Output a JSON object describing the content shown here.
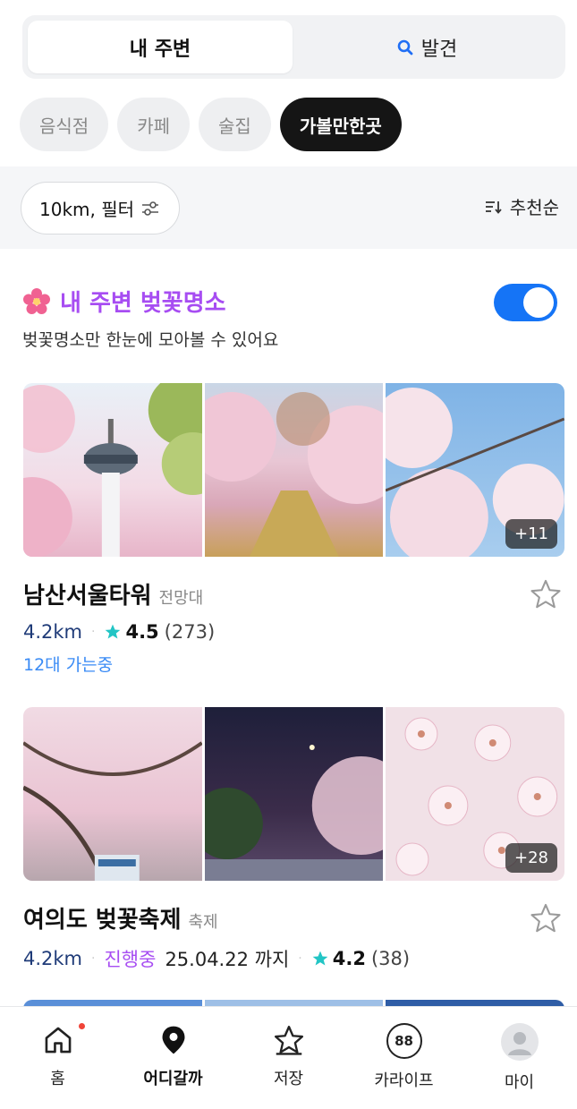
{
  "tabs": {
    "nearby": "내 주변",
    "discover": "발견"
  },
  "categories": [
    "음식점",
    "카페",
    "술집",
    "가볼만한곳"
  ],
  "filter": {
    "label": "10km, 필터",
    "sort": "추천순"
  },
  "section": {
    "title": "내 주변 벚꽃명소",
    "subtitle": "벚꽃명소만 한눈에 모아볼 수 있어요",
    "toggle_on": true
  },
  "places": [
    {
      "name": "남산서울타워",
      "category": "전망대",
      "distance": "4.2km",
      "rating": "4.5",
      "reviews": "(273)",
      "going": "12대 가는중",
      "more_photos": "+11"
    },
    {
      "name": "여의도 벚꽃축제",
      "category": "축제",
      "distance": "4.2km",
      "status": "진행중",
      "until": "25.04.22 까지",
      "rating": "4.2",
      "reviews": "(38)",
      "more_photos": "+28"
    }
  ],
  "nav": {
    "home": "홈",
    "where": "어디갈까",
    "saved": "저장",
    "kalife": "카라이프",
    "kalife_badge": "88",
    "my": "마이"
  },
  "colors": {
    "accent_blue": "#1574f6",
    "purple": "#a74df2",
    "teal_star": "#22c5c5"
  }
}
